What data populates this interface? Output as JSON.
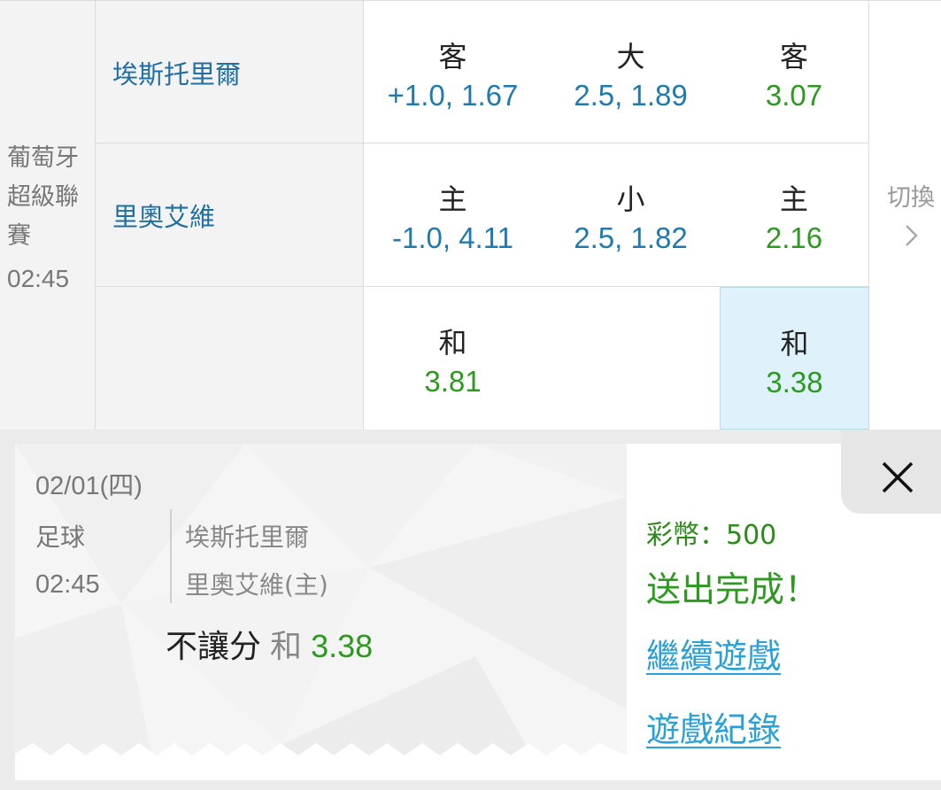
{
  "league": {
    "name": "葡萄牙超級聯賽",
    "time": "02:45"
  },
  "teams": {
    "away": "埃斯托里爾",
    "home": "里奧艾維"
  },
  "odds": {
    "row1": [
      {
        "label": "客",
        "value": "+1.0, 1.67",
        "color": "#1f7ab0"
      },
      {
        "label": "大",
        "value": "2.5, 1.89",
        "color": "#1f7ab0"
      },
      {
        "label": "客",
        "value": "3.07",
        "color": "#2c9a1e"
      }
    ],
    "row2": [
      {
        "label": "主",
        "value": "-1.0, 4.11",
        "color": "#1f7ab0"
      },
      {
        "label": "小",
        "value": "2.5, 1.82",
        "color": "#1f7ab0"
      },
      {
        "label": "主",
        "value": "2.16",
        "color": "#2c9a1e"
      }
    ],
    "row3": [
      {
        "label": "和",
        "value": "3.81",
        "color": "#2c9a1e"
      },
      {
        "label": "和",
        "value": "3.38",
        "color": "#2c9a1e",
        "selected": true
      }
    ]
  },
  "switch": {
    "label": "切換",
    "icon": "chevron-right-icon"
  },
  "slip": {
    "date": "02/01(四)",
    "sport": "足球",
    "time": "02:45",
    "away": "埃斯托里爾",
    "home": "里奧艾維(主)",
    "bet_type": "不讓分",
    "pick": "和",
    "odds": "3.38",
    "credits": "彩幣：500",
    "status": "送出完成！",
    "continue_link": "繼續遊戲",
    "history_link": "遊戲紀錄",
    "close_icon": "close-icon"
  }
}
